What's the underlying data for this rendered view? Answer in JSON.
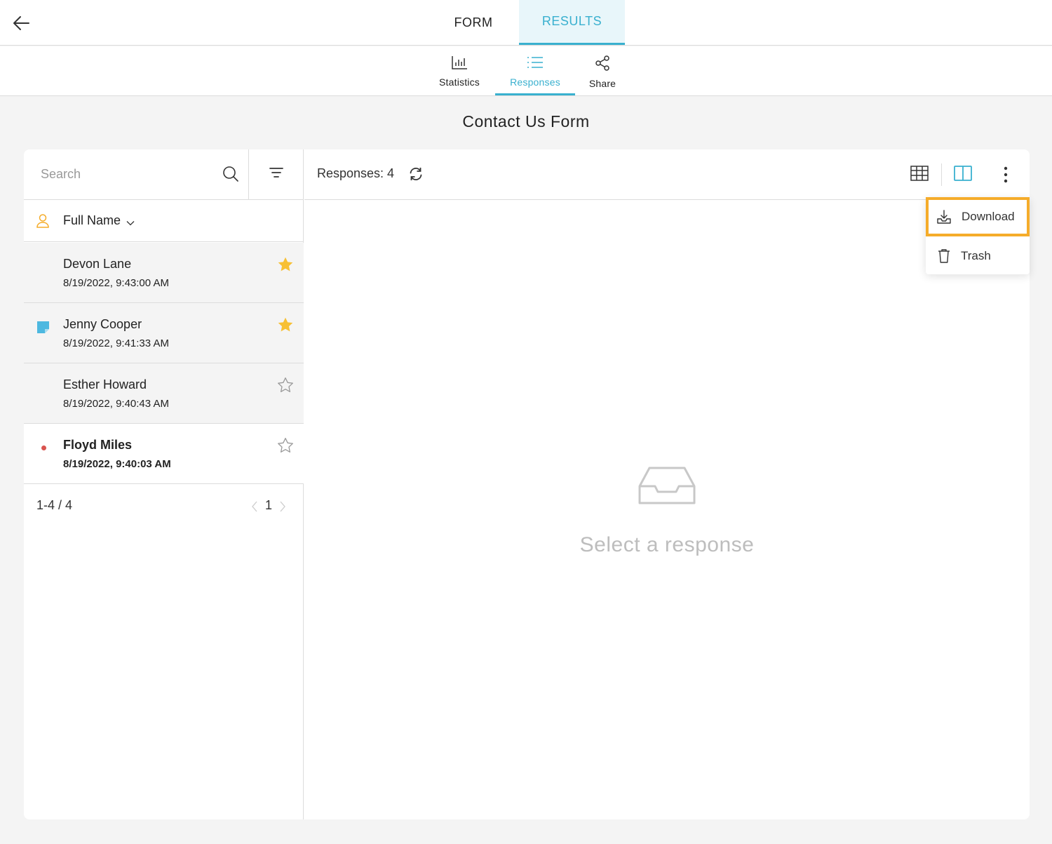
{
  "top_tabs": {
    "form": "FORM",
    "results": "RESULTS"
  },
  "sub_tabs": {
    "statistics": "Statistics",
    "responses": "Responses",
    "share": "Share"
  },
  "page_title": "Contact Us Form",
  "search": {
    "placeholder": "Search",
    "value": ""
  },
  "sort": {
    "label": "Full Name"
  },
  "responses": [
    {
      "name": "Devon Lane",
      "date": "8/19/2022, 9:43:00 AM",
      "starred": true,
      "note": false,
      "unread": false
    },
    {
      "name": "Jenny Cooper",
      "date": "8/19/2022, 9:41:33 AM",
      "starred": true,
      "note": true,
      "unread": false
    },
    {
      "name": "Esther Howard",
      "date": "8/19/2022, 9:40:43 AM",
      "starred": false,
      "note": false,
      "unread": false
    },
    {
      "name": "Floyd Miles",
      "date": "8/19/2022, 9:40:03 AM",
      "starred": false,
      "note": false,
      "unread": true
    }
  ],
  "pager": {
    "range": "1-4 / 4",
    "page": "1"
  },
  "responses_count_label": "Responses: 4",
  "menu": {
    "download": "Download",
    "trash": "Trash"
  },
  "empty_state": {
    "text": "Select a response"
  },
  "colors": {
    "accent": "#39b0cf",
    "star": "#f7c034",
    "highlight": "#f5ac2a",
    "unread_dot": "#d9534f"
  }
}
